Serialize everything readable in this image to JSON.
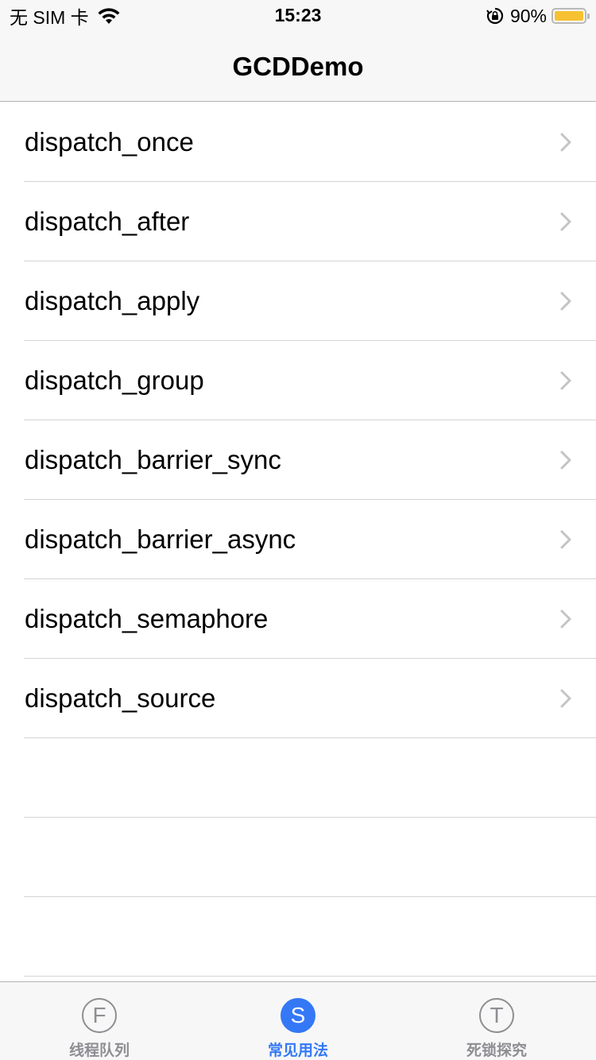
{
  "status_bar": {
    "carrier": "无 SIM 卡",
    "time": "15:23",
    "battery_percent": "90%",
    "battery_level": 0.9,
    "battery_color": "#f6c233",
    "icons": [
      "wifi-icon",
      "orientation-lock-icon",
      "battery-icon"
    ]
  },
  "nav": {
    "title": "GCDDemo"
  },
  "list": {
    "items": [
      {
        "label": "dispatch_once"
      },
      {
        "label": "dispatch_after"
      },
      {
        "label": "dispatch_apply"
      },
      {
        "label": "dispatch_group"
      },
      {
        "label": "dispatch_barrier_sync"
      },
      {
        "label": "dispatch_barrier_async"
      },
      {
        "label": "dispatch_semaphore"
      },
      {
        "label": "dispatch_source"
      },
      {
        "label": ""
      },
      {
        "label": ""
      },
      {
        "label": ""
      }
    ]
  },
  "tab_bar": {
    "accent_color": "#3478f6",
    "inactive_color": "#8e8e93",
    "tabs": [
      {
        "letter": "F",
        "label": "线程队列",
        "active": false
      },
      {
        "letter": "S",
        "label": "常见用法",
        "active": true
      },
      {
        "letter": "T",
        "label": "死锁探究",
        "active": false
      }
    ]
  }
}
